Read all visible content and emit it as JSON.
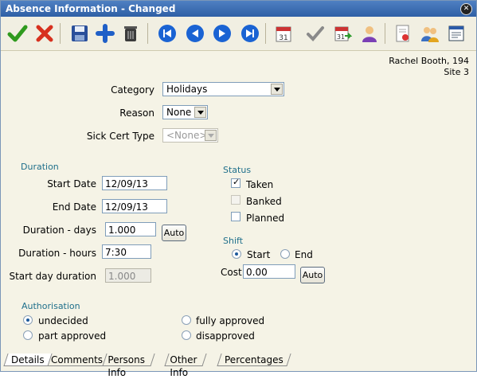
{
  "window": {
    "title": "Absence Information - Changed"
  },
  "toolbar": {
    "buttons": [
      {
        "name": "accept-icon"
      },
      {
        "name": "cancel-icon"
      },
      {
        "name": "save-icon"
      },
      {
        "name": "add-icon"
      },
      {
        "name": "delete-icon"
      },
      {
        "name": "first-record-icon"
      },
      {
        "name": "previous-record-icon"
      },
      {
        "name": "next-record-icon"
      },
      {
        "name": "last-record-icon"
      },
      {
        "name": "calendar-icon"
      },
      {
        "name": "approve-icon"
      },
      {
        "name": "calendar-go-icon"
      },
      {
        "name": "person-icon"
      },
      {
        "name": "certificate-icon"
      },
      {
        "name": "group-icon"
      },
      {
        "name": "report-icon"
      }
    ]
  },
  "person": {
    "name": "Rachel Booth, 194",
    "site": "Site 3"
  },
  "form": {
    "category_label": "Category",
    "category_value": "Holidays",
    "reason_label": "Reason",
    "reason_value": "None",
    "sickcert_label": "Sick Cert Type",
    "sickcert_value": "<None>"
  },
  "duration": {
    "section": "Duration",
    "start_date_label": "Start Date",
    "start_date": "12/09/13",
    "end_date_label": "End Date",
    "end_date": "12/09/13",
    "days_label": "Duration - days",
    "days": "1.000",
    "auto_label": "Auto",
    "hours_label": "Duration - hours",
    "hours": "7:30",
    "start_day_label": "Start day duration",
    "start_day": "1.000"
  },
  "status": {
    "section": "Status",
    "options": [
      {
        "label": "Taken",
        "checked": true
      },
      {
        "label": "Banked",
        "checked": false
      },
      {
        "label": "Planned",
        "checked": false
      }
    ]
  },
  "shift": {
    "section": "Shift",
    "start_label": "Start",
    "end_label": "End",
    "selected": "Start",
    "cost_label": "Cost",
    "cost": "0.00",
    "auto_label": "Auto"
  },
  "authorisation": {
    "section": "Authorisation",
    "options": [
      {
        "label": "undecided",
        "selected": true
      },
      {
        "label": "part approved",
        "selected": false
      },
      {
        "label": "fully approved",
        "selected": false
      },
      {
        "label": "disapproved",
        "selected": false
      }
    ]
  },
  "tabs": [
    {
      "label": "Details",
      "active": true
    },
    {
      "label": "Comments",
      "active": false
    },
    {
      "label": "Persons Info",
      "active": false
    },
    {
      "label": "Other Info",
      "active": false
    },
    {
      "label": "Percentages",
      "active": false
    }
  ],
  "colors": {
    "title_bar": "#3a6db5",
    "section_label": "#1f6f8b",
    "background": "#f5f3e6"
  }
}
